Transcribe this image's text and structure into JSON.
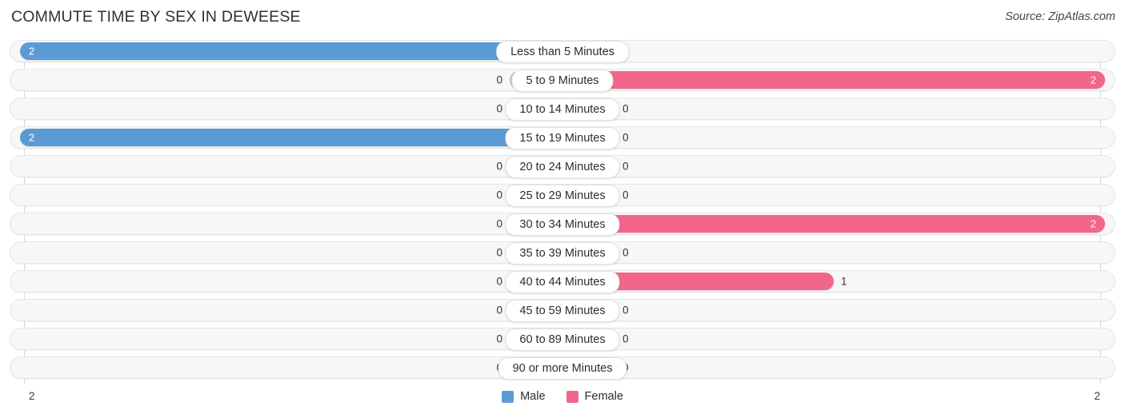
{
  "header": {
    "title": "COMMUTE TIME BY SEX IN DEWEESE",
    "source": "Source: ZipAtlas.com"
  },
  "legend": {
    "male_label": "Male",
    "female_label": "Female",
    "male_color": "#5b9bd5",
    "female_color": "#f2668b"
  },
  "axis": {
    "left_label": "2",
    "right_label": "2"
  },
  "colors": {
    "male_strong": "#5b9bd5",
    "male_faint": "#a8c8ec",
    "female_strong": "#f2668b",
    "female_faint": "#f9afc4",
    "track": "#f7f7f7"
  },
  "chart_data": {
    "type": "bar",
    "subtype": "diverging-bidirectional",
    "title": "COMMUTE TIME BY SEX IN DEWEESE",
    "xlabel": "",
    "ylabel": "",
    "xlim": [
      2,
      2
    ],
    "axis_left_max": 2,
    "axis_right_max": 2,
    "grid": false,
    "legend_position": "bottom-center",
    "categories": [
      "Less than 5 Minutes",
      "5 to 9 Minutes",
      "10 to 14 Minutes",
      "15 to 19 Minutes",
      "20 to 24 Minutes",
      "25 to 29 Minutes",
      "30 to 34 Minutes",
      "35 to 39 Minutes",
      "40 to 44 Minutes",
      "45 to 59 Minutes",
      "60 to 89 Minutes",
      "90 or more Minutes"
    ],
    "series": [
      {
        "name": "Male",
        "direction": "left",
        "values": [
          2,
          0,
          0,
          2,
          0,
          0,
          0,
          0,
          0,
          0,
          0,
          0
        ]
      },
      {
        "name": "Female",
        "direction": "right",
        "values": [
          0,
          2,
          0,
          0,
          0,
          0,
          2,
          0,
          1,
          0,
          0,
          0
        ]
      }
    ]
  },
  "rows": [
    {
      "label": "Less than 5 Minutes",
      "male": "2",
      "female": "0"
    },
    {
      "label": "5 to 9 Minutes",
      "male": "0",
      "female": "2"
    },
    {
      "label": "10 to 14 Minutes",
      "male": "0",
      "female": "0"
    },
    {
      "label": "15 to 19 Minutes",
      "male": "2",
      "female": "0"
    },
    {
      "label": "20 to 24 Minutes",
      "male": "0",
      "female": "0"
    },
    {
      "label": "25 to 29 Minutes",
      "male": "0",
      "female": "0"
    },
    {
      "label": "30 to 34 Minutes",
      "male": "0",
      "female": "2"
    },
    {
      "label": "35 to 39 Minutes",
      "male": "0",
      "female": "0"
    },
    {
      "label": "40 to 44 Minutes",
      "male": "0",
      "female": "1"
    },
    {
      "label": "45 to 59 Minutes",
      "male": "0",
      "female": "0"
    },
    {
      "label": "60 to 89 Minutes",
      "male": "0",
      "female": "0"
    },
    {
      "label": "90 or more Minutes",
      "male": "0",
      "female": "0"
    }
  ]
}
